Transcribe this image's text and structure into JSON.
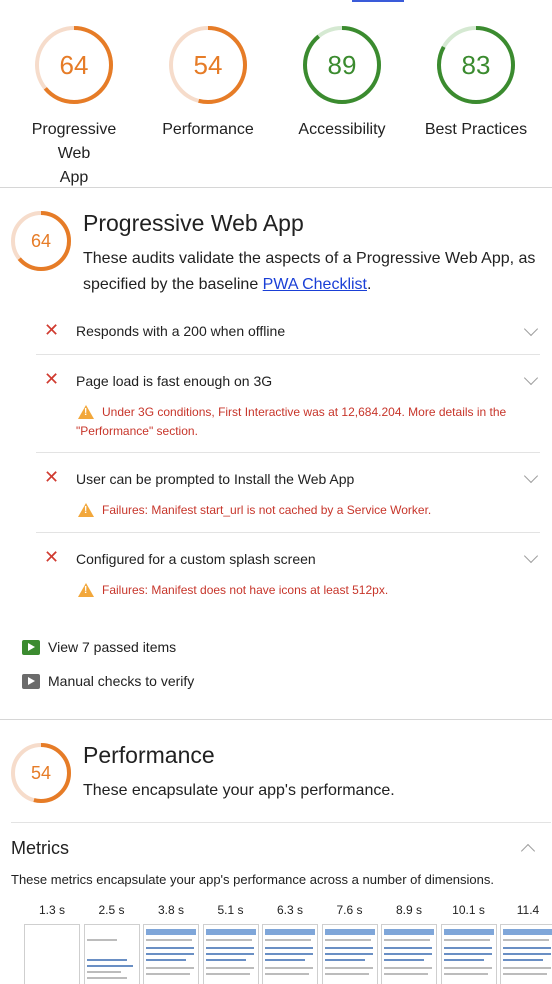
{
  "summary": [
    {
      "score": "64",
      "label_lines": [
        "Progressive Web",
        "App"
      ],
      "color": "#e67c27",
      "track": "#f6dccb",
      "fraction": 0.64
    },
    {
      "score": "54",
      "label_lines": [
        "Performance"
      ],
      "color": "#e67c27",
      "track": "#f6dccb",
      "fraction": 0.54
    },
    {
      "score": "89",
      "label_lines": [
        "Accessibility"
      ],
      "color": "#3b8b2f",
      "track": "#d5e9d2",
      "fraction": 0.89
    },
    {
      "score": "83",
      "label_lines": [
        "Best Practices"
      ],
      "color": "#3b8b2f",
      "track": "#d5e9d2",
      "fraction": 0.83
    }
  ],
  "pwa": {
    "score": "64",
    "fraction": 0.64,
    "title": "Progressive Web App",
    "desc_before": "These audits validate the aspects of a Progressive Web App, as specified by the baseline ",
    "desc_link": "PWA Checklist",
    "desc_after": ".",
    "audits": [
      {
        "title": "Responds with a 200 when offline",
        "warning": ""
      },
      {
        "title": "Page load is fast enough on 3G",
        "warning": "Under 3G conditions, First Interactive was at 12,684.204. More details in the \"Performance\" section."
      },
      {
        "title": "User can be prompted to Install the Web App",
        "warning": "Failures: Manifest start_url is not cached by a Service Worker."
      },
      {
        "title": "Configured for a custom splash screen",
        "warning": "Failures: Manifest does not have icons at least 512px."
      }
    ],
    "passed_label": "View 7 passed items",
    "manual_label": "Manual checks to verify"
  },
  "performance": {
    "score": "54",
    "fraction": 0.54,
    "title": "Performance",
    "desc": "These encapsulate your app's performance.",
    "metrics_title": "Metrics",
    "metrics_desc": "These metrics encapsulate your app's performance across a number of dimensions.",
    "filmstrip_times": [
      "1.3 s",
      "2.5 s",
      "3.8 s",
      "5.1 s",
      "6.3 s",
      "7.6 s",
      "8.9 s",
      "10.1 s",
      "11.4"
    ]
  },
  "colors": {
    "fail": "#d03b30",
    "warn": "#f2a73b",
    "pass": "#3b8b2f",
    "manual": "#757575",
    "link": "#1a3fd6"
  },
  "icons": {
    "fail": "cross-icon",
    "warning": "warning-triangle-icon",
    "expand": "chevron-down-icon",
    "collapse": "chevron-up-icon",
    "passed": "play-icon"
  }
}
